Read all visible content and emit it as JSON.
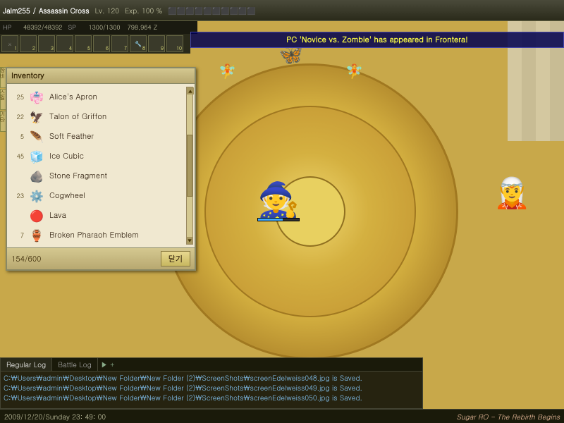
{
  "window": {
    "title": "Sugar RO - The Rebirth Begins"
  },
  "hud": {
    "player_name": "Jalm255",
    "job_class": "Assassin Cross",
    "level": "Lv. 120",
    "exp": "Exp. 100 %",
    "hp_current": "48392",
    "hp_max": "48392",
    "sp_current": "1300",
    "sp_max": "1300",
    "zeny": "798,964 Z",
    "hp_label": "HP",
    "sp_label": "SP"
  },
  "announcement": {
    "text": "PC 'Novice vs. Zombie' has appeared in Frontera!"
  },
  "inventory": {
    "title": "Inventory",
    "capacity": "154/600",
    "close_button": "닫기",
    "items": [
      {
        "id": 1,
        "name": "Alice's Apron",
        "count": 25,
        "icon": "👘"
      },
      {
        "id": 2,
        "name": "Talon of Griffon",
        "count": 22,
        "icon": "🦅"
      },
      {
        "id": 3,
        "name": "Soft Feather",
        "count": 5,
        "icon": "🪶"
      },
      {
        "id": 4,
        "name": "Ice Cubic",
        "count": 45,
        "icon": "🧊"
      },
      {
        "id": 5,
        "name": "Stone Fragment",
        "count": "",
        "icon": "🪨"
      },
      {
        "id": 6,
        "name": "Cogwheel",
        "count": 23,
        "icon": "⚙️"
      },
      {
        "id": 7,
        "name": "Lava",
        "count": "",
        "icon": "🔴"
      },
      {
        "id": 8,
        "name": "Broken Pharaoh Emblem",
        "count": 7,
        "icon": "🏺"
      }
    ]
  },
  "log": {
    "tabs": [
      {
        "label": "Regular Log",
        "active": true
      },
      {
        "label": "Battle Log",
        "active": false
      }
    ],
    "add_tab": "+",
    "lines": [
      "C:\\Users\\admin\\Desktop\\New Folder\\New Folder (2)\\ScreenShots\\screenEdelweiss048.jpg is Saved.",
      "C:\\Users\\admin\\Desktop\\New Folder\\New Folder (2)\\ScreenShots\\screenEdelweiss049.jpg is Saved.",
      "C:\\Users\\admin\\Desktop\\New Folder\\New Folder (2)\\ScreenShots\\screenEdelweiss050.jpg is Saved."
    ]
  },
  "status_bar": {
    "datetime": "2009/12/20/Sunday  23: 49: 00",
    "server": "Sugar RO - The Rebirth Begins"
  },
  "quick_slots": [
    {
      "num": 1,
      "icon": "⚔"
    },
    {
      "num": 2,
      "icon": ""
    },
    {
      "num": 3,
      "icon": ""
    },
    {
      "num": 4,
      "icon": ""
    },
    {
      "num": 5,
      "icon": ""
    },
    {
      "num": 6,
      "icon": ""
    },
    {
      "num": 7,
      "icon": ""
    },
    {
      "num": 8,
      "icon": "🔧"
    },
    {
      "num": 9,
      "icon": ""
    },
    {
      "num": 10,
      "icon": ""
    }
  ],
  "left_tabs": [
    {
      "label": "장비"
    },
    {
      "label": "스킬"
    },
    {
      "label": "기타"
    }
  ]
}
